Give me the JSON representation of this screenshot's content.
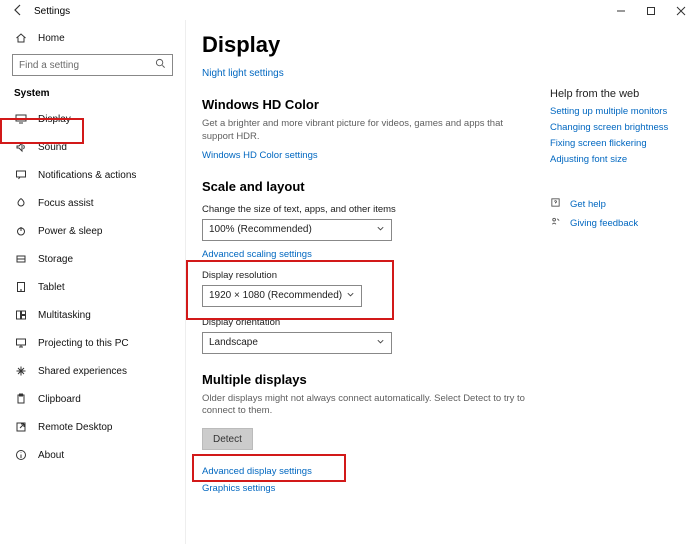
{
  "titlebar": {
    "title": "Settings"
  },
  "sidebar": {
    "home": "Home",
    "search_placeholder": "Find a setting",
    "system_label": "System",
    "items": [
      "Display",
      "Sound",
      "Notifications & actions",
      "Focus assist",
      "Power & sleep",
      "Storage",
      "Tablet",
      "Multitasking",
      "Projecting to this PC",
      "Shared experiences",
      "Clipboard",
      "Remote Desktop",
      "About"
    ]
  },
  "main": {
    "page_title": "Display",
    "night_light_link": "Night light settings",
    "hd": {
      "heading": "Windows HD Color",
      "desc": "Get a brighter and more vibrant picture for videos, games and apps that support HDR.",
      "link": "Windows HD Color settings"
    },
    "scale": {
      "heading": "Scale and layout",
      "scale_label": "Change the size of text, apps, and other items",
      "scale_value": "100% (Recommended)",
      "advanced_scaling": "Advanced scaling settings",
      "resolution_label": "Display resolution",
      "resolution_value": "1920 × 1080 (Recommended)",
      "orientation_label": "Display orientation",
      "orientation_value": "Landscape"
    },
    "multi": {
      "heading": "Multiple displays",
      "desc": "Older displays might not always connect automatically. Select Detect to try to connect to them.",
      "detect": "Detect",
      "advanced": "Advanced display settings",
      "graphics": "Graphics settings"
    }
  },
  "help": {
    "heading": "Help from the web",
    "links": [
      "Setting up multiple monitors",
      "Changing screen brightness",
      "Fixing screen flickering",
      "Adjusting font size"
    ],
    "get_help": "Get help",
    "feedback": "Giving feedback"
  }
}
